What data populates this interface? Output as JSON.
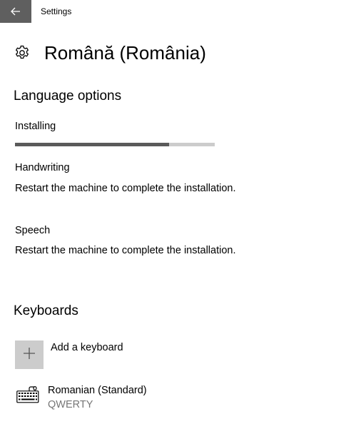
{
  "window": {
    "app_title": "Settings"
  },
  "header": {
    "title": "Română (România)",
    "icon": "gear-icon"
  },
  "language_options": {
    "section_title": "Language options",
    "installing_label": "Installing",
    "progress_percent": 77,
    "handwriting": {
      "label": "Handwriting",
      "status": "Restart the machine to complete the installation."
    },
    "speech": {
      "label": "Speech",
      "status": "Restart the machine to complete the installation."
    }
  },
  "keyboards": {
    "section_title": "Keyboards",
    "add_label": "Add a keyboard",
    "items": [
      {
        "name": "Romanian (Standard)",
        "layout": "QWERTY",
        "icon": "keyboard-icon"
      }
    ]
  },
  "colors": {
    "back_button_bg": "#5f5f5f",
    "progress_fill": "#5a5a5a",
    "progress_track": "#cccccc",
    "secondary_text": "#767676"
  }
}
